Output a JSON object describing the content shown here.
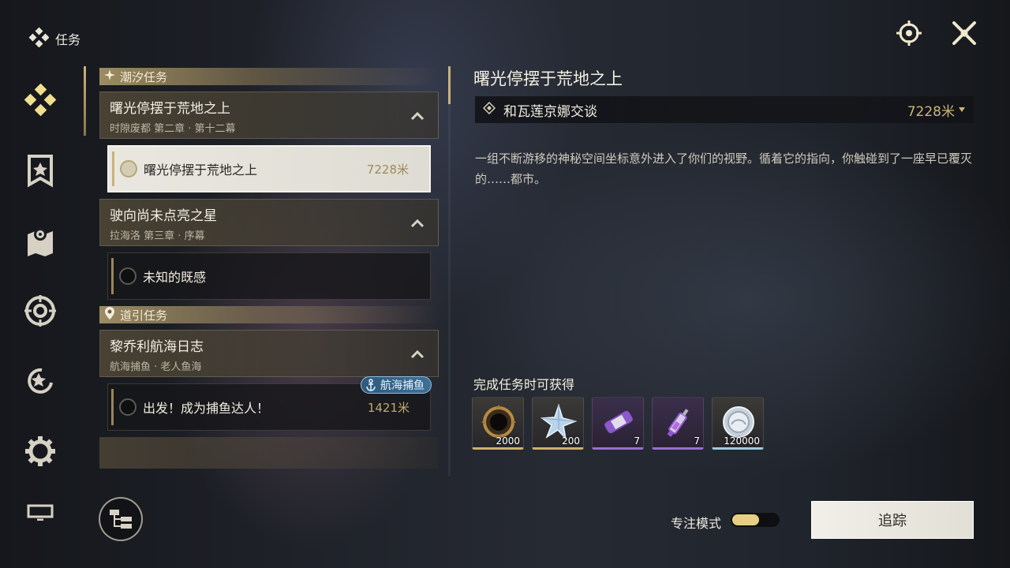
{
  "header": {
    "title": "任务",
    "icon": "quest-diamond-icon"
  },
  "top_icons": [
    "target-crosshair-icon",
    "close-x-icon"
  ],
  "sidebar": {
    "items": [
      {
        "name": "sidebar-item-quests",
        "icon": "four-diamond-icon",
        "active": true
      },
      {
        "name": "sidebar-item-banner",
        "icon": "banner-shield-icon"
      },
      {
        "name": "sidebar-item-map",
        "icon": "map-pin-icon"
      },
      {
        "name": "sidebar-item-target",
        "icon": "crosshair-circle-icon"
      },
      {
        "name": "sidebar-item-refresh",
        "icon": "star-refresh-icon"
      },
      {
        "name": "sidebar-item-settings",
        "icon": "gear-icon"
      },
      {
        "name": "sidebar-item-screen",
        "icon": "monitor-icon"
      }
    ]
  },
  "quest_list": {
    "sections": [
      {
        "title": "潮汐任务",
        "icon": "sparkle-icon",
        "groups": [
          {
            "name": "曙光停摆于荒地之上",
            "sub": "时隙废都 第二章 · 第十二幕",
            "items": [
              {
                "name": "曙光停摆于荒地之上",
                "distance": "7228米",
                "selected": true
              }
            ]
          },
          {
            "name": "驶向尚未点亮之星",
            "sub": "拉海洛 第三章 · 序幕",
            "items": [
              {
                "name": "未知的既感",
                "distance": ""
              }
            ]
          }
        ]
      },
      {
        "title": "道引任务",
        "icon": "location-pin-icon",
        "groups": [
          {
            "name": "黎乔利航海日志",
            "sub": "航海捕鱼 · 老人鱼海",
            "items": [
              {
                "name": "出发！成为捕鱼达人！",
                "distance": "1421米",
                "tag": "航海捕鱼"
              }
            ]
          }
        ]
      }
    ]
  },
  "detail": {
    "title": "曙光停摆于荒地之上",
    "objective": "和瓦莲京娜交谈",
    "objective_distance": "7228米",
    "description": "一组不断游移的神秘空间坐标意外进入了你们的视野。循着它的指向，你触碰到了一座早已覆灭的……都市。",
    "rewards_title": "完成任务时可获得",
    "rewards": [
      {
        "name": "ring-artifact-icon",
        "qty": "2000",
        "rarity": "gold"
      },
      {
        "name": "crystal-star-icon",
        "qty": "200",
        "rarity": "gold"
      },
      {
        "name": "purple-capsule-icon",
        "qty": "7",
        "rarity": "purple"
      },
      {
        "name": "purple-syringe-icon",
        "qty": "7",
        "rarity": "purple"
      },
      {
        "name": "silver-coin-icon",
        "qty": "120000",
        "rarity": "blue"
      }
    ]
  },
  "bottom": {
    "focus_mode_label": "专注模式",
    "focus_mode_on": true,
    "track_button": "追踪"
  },
  "colors": {
    "accent_gold": "#cdb578",
    "panel_dark": "#161618"
  }
}
